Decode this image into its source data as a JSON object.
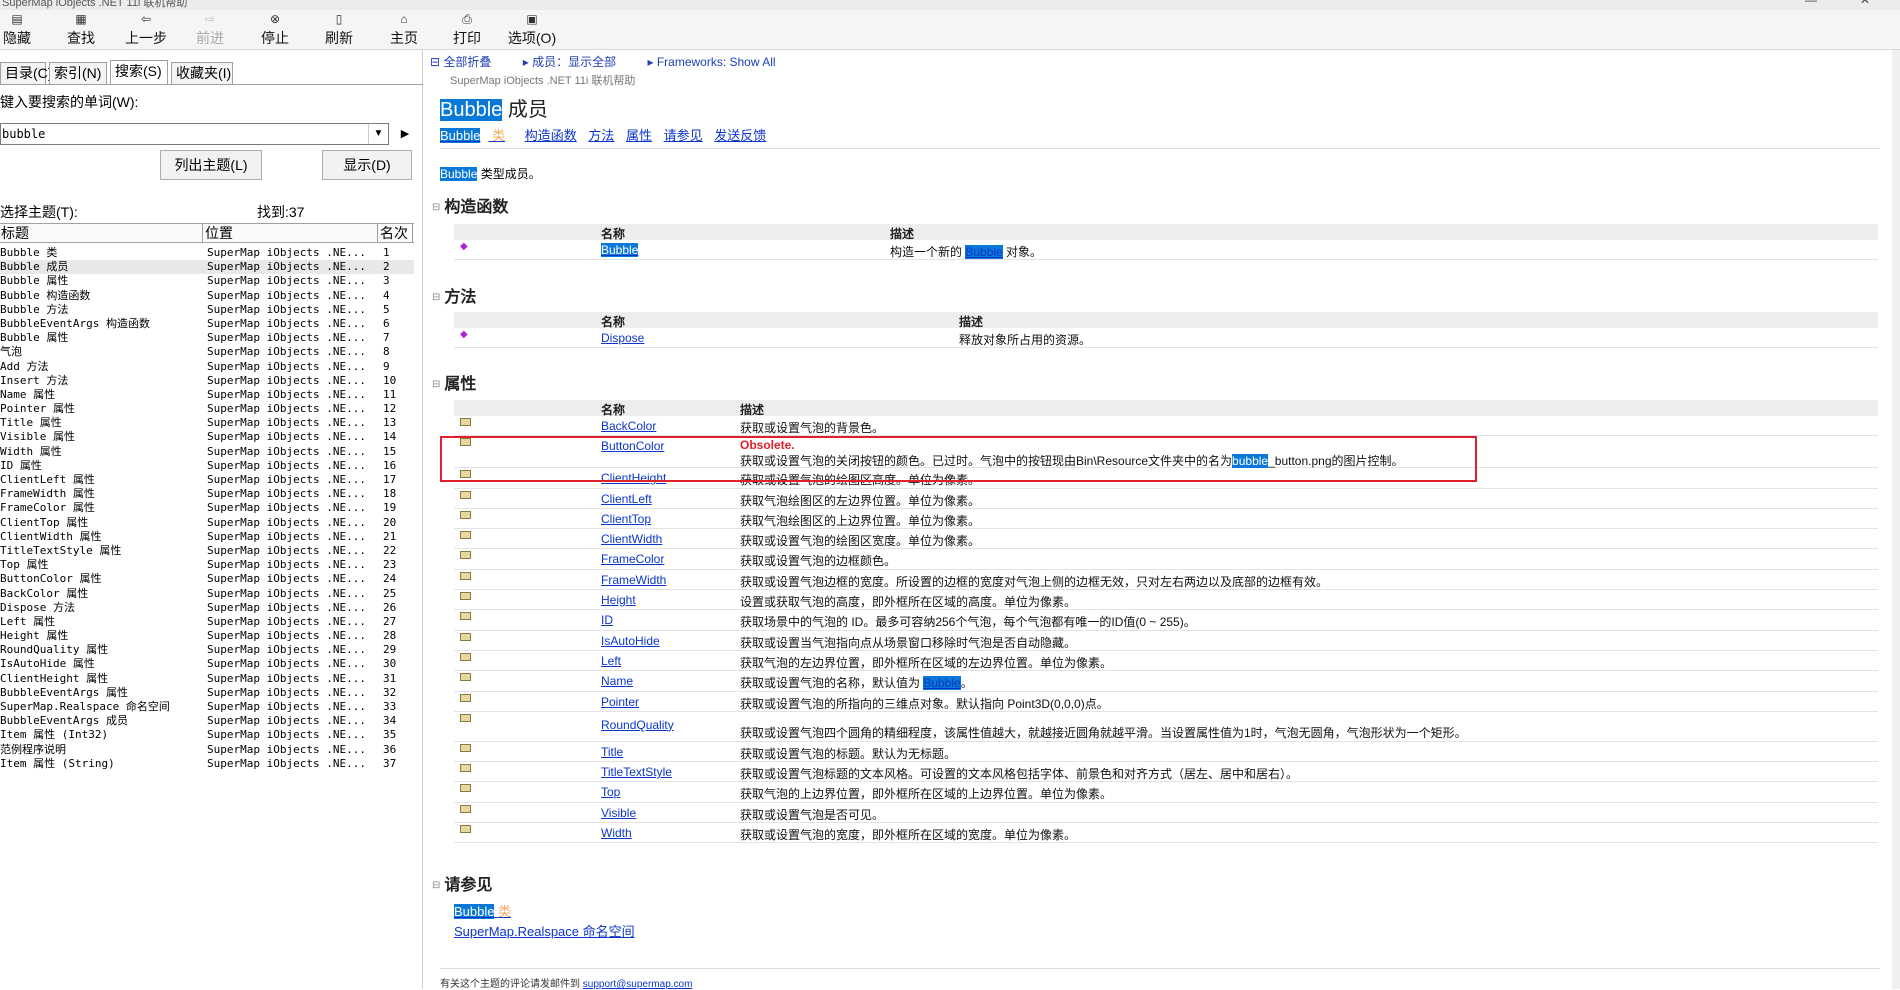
{
  "window": {
    "title": "SuperMap iObjects .NET 11i 联机帮助"
  },
  "toolbar": {
    "buttons": [
      {
        "label": "隐藏",
        "icon": "hide-icon",
        "enabled": true
      },
      {
        "label": "查找",
        "icon": "locate-icon",
        "enabled": true
      },
      {
        "label": "上一步",
        "icon": "back-arrow-icon",
        "enabled": true
      },
      {
        "label": "前进",
        "icon": "forward-arrow-icon",
        "enabled": false
      },
      {
        "label": "停止",
        "icon": "stop-icon",
        "enabled": true
      },
      {
        "label": "刷新",
        "icon": "refresh-icon",
        "enabled": true
      },
      {
        "label": "主页",
        "icon": "home-icon",
        "enabled": true
      },
      {
        "label": "打印",
        "icon": "print-icon",
        "enabled": true
      },
      {
        "label": "选项(O)",
        "icon": "options-icon",
        "enabled": true
      }
    ]
  },
  "left": {
    "tabs": [
      "目录(C)",
      "索引(N)",
      "搜索(S)",
      "收藏夹(I)"
    ],
    "active_tab": 2,
    "search_prompt": "键入要搜索的单词(W):",
    "search_value": "bubble",
    "list_topics_label": "列出主题(L)",
    "display_label": "显示(D)",
    "select_topic_label": "选择主题(T):",
    "found_label": "找到:37",
    "columns": [
      "标题",
      "位置",
      "名次"
    ],
    "results": [
      {
        "title": "Bubble 类",
        "location": "SuperMap iObjects .NE...",
        "rank": "1"
      },
      {
        "title": "Bubble 成员",
        "location": "SuperMap iObjects .NE...",
        "rank": "2"
      },
      {
        "title": "Bubble 属性",
        "location": "SuperMap iObjects .NE...",
        "rank": "3"
      },
      {
        "title": "Bubble 构造函数",
        "location": "SuperMap iObjects .NE...",
        "rank": "4"
      },
      {
        "title": "Bubble 方法",
        "location": "SuperMap iObjects .NE...",
        "rank": "5"
      },
      {
        "title": "BubbleEventArgs 构造函数",
        "location": "SuperMap iObjects .NE...",
        "rank": "6"
      },
      {
        "title": "Bubble 属性",
        "location": "SuperMap iObjects .NE...",
        "rank": "7"
      },
      {
        "title": "气泡",
        "location": "SuperMap iObjects .NE...",
        "rank": "8"
      },
      {
        "title": "Add 方法",
        "location": "SuperMap iObjects .NE...",
        "rank": "9"
      },
      {
        "title": "Insert 方法",
        "location": "SuperMap iObjects .NE...",
        "rank": "10"
      },
      {
        "title": "Name 属性",
        "location": "SuperMap iObjects .NE...",
        "rank": "11"
      },
      {
        "title": "Pointer 属性",
        "location": "SuperMap iObjects .NE...",
        "rank": "12"
      },
      {
        "title": "Title 属性",
        "location": "SuperMap iObjects .NE...",
        "rank": "13"
      },
      {
        "title": "Visible 属性",
        "location": "SuperMap iObjects .NE...",
        "rank": "14"
      },
      {
        "title": "Width 属性",
        "location": "SuperMap iObjects .NE...",
        "rank": "15"
      },
      {
        "title": "ID 属性",
        "location": "SuperMap iObjects .NE...",
        "rank": "16"
      },
      {
        "title": "ClientLeft 属性",
        "location": "SuperMap iObjects .NE...",
        "rank": "17"
      },
      {
        "title": "FrameWidth 属性",
        "location": "SuperMap iObjects .NE...",
        "rank": "18"
      },
      {
        "title": "FrameColor 属性",
        "location": "SuperMap iObjects .NE...",
        "rank": "19"
      },
      {
        "title": "ClientTop 属性",
        "location": "SuperMap iObjects .NE...",
        "rank": "20"
      },
      {
        "title": "ClientWidth 属性",
        "location": "SuperMap iObjects .NE...",
        "rank": "21"
      },
      {
        "title": "TitleTextStyle 属性",
        "location": "SuperMap iObjects .NE...",
        "rank": "22"
      },
      {
        "title": "Top 属性",
        "location": "SuperMap iObjects .NE...",
        "rank": "23"
      },
      {
        "title": "ButtonColor 属性",
        "location": "SuperMap iObjects .NE...",
        "rank": "24"
      },
      {
        "title": "BackColor 属性",
        "location": "SuperMap iObjects .NE...",
        "rank": "25"
      },
      {
        "title": "Dispose 方法",
        "location": "SuperMap iObjects .NE...",
        "rank": "26"
      },
      {
        "title": "Left 属性",
        "location": "SuperMap iObjects .NE...",
        "rank": "27"
      },
      {
        "title": "Height 属性",
        "location": "SuperMap iObjects .NE...",
        "rank": "28"
      },
      {
        "title": "RoundQuality 属性",
        "location": "SuperMap iObjects .NE...",
        "rank": "29"
      },
      {
        "title": "IsAutoHide 属性",
        "location": "SuperMap iObjects .NE...",
        "rank": "30"
      },
      {
        "title": "ClientHeight 属性",
        "location": "SuperMap iObjects .NE...",
        "rank": "31"
      },
      {
        "title": "BubbleEventArgs 属性",
        "location": "SuperMap iObjects .NE...",
        "rank": "32"
      },
      {
        "title": "SuperMap.Realspace 命名空间",
        "location": "SuperMap iObjects .NE...",
        "rank": "33"
      },
      {
        "title": "BubbleEventArgs 成员",
        "location": "SuperMap iObjects .NE...",
        "rank": "34"
      },
      {
        "title": "Item 属性 (Int32)",
        "location": "SuperMap iObjects .NE...",
        "rank": "35"
      },
      {
        "title": "范例程序说明",
        "location": "SuperMap iObjects .NE...",
        "rank": "36"
      },
      {
        "title": "Item 属性 (String)",
        "location": "SuperMap iObjects .NE...",
        "rank": "37"
      }
    ]
  },
  "doc": {
    "nav": [
      "全部折叠",
      "成员：显示全部",
      "Frameworks: Show All"
    ],
    "subtitle": "SuperMap iObjects .NET 11i 联机帮助",
    "title_hl": "Bubble",
    "title_rest": " 成员",
    "linkbar": {
      "class_hl": "Bubble",
      "class_suffix": " 类",
      "links": [
        "构造函数",
        "方法",
        "属性",
        "请参见",
        "发送反馈"
      ]
    },
    "intro_hl": "Bubble",
    "intro_rest": " 类型成员。",
    "col_name": "名称",
    "col_desc": "描述",
    "sections": {
      "ctor": {
        "title": "构造函数",
        "rows": [
          {
            "name": "Bubble",
            "desc_pre": "构造一个新的 ",
            "desc_hl": "Bubble",
            "desc_post": " 对象。"
          }
        ]
      },
      "methods": {
        "title": "方法",
        "rows": [
          {
            "name": "Dispose",
            "desc": "释放对象所占用的资源。"
          }
        ]
      },
      "props": {
        "title": "属性",
        "obsolete_label": "Obsolete.",
        "obsolete_desc_pre": "获取或设置气泡的关闭按钮的颜色。已过时。气泡中的按钮现由Bin\\Resource文件夹中的名为",
        "obsolete_desc_hl": "bubble",
        "obsolete_desc_post": "_button.png的图片控制。",
        "name_desc_pre": "获取或设置气泡的名称，默认值为 ",
        "name_desc_hl": "Bubble",
        "name_desc_post": "。",
        "rows": [
          {
            "name": "BackColor",
            "desc": "获取或设置气泡的背景色。"
          },
          {
            "name": "ButtonColor",
            "desc": ""
          },
          {
            "name": "ClientHeight",
            "desc": "获取或设置气泡的绘图区高度。单位为像素。"
          },
          {
            "name": "ClientLeft",
            "desc": "获取气泡绘图区的左边界位置。单位为像素。"
          },
          {
            "name": "ClientTop",
            "desc": "获取气泡绘图区的上边界位置。单位为像素。"
          },
          {
            "name": "ClientWidth",
            "desc": "获取或设置气泡的绘图区宽度。单位为像素。"
          },
          {
            "name": "FrameColor",
            "desc": "获取或设置气泡的边框颜色。"
          },
          {
            "name": "FrameWidth",
            "desc": "获取或设置气泡边框的宽度。所设置的边框的宽度对气泡上侧的边框无效，只对左右两边以及底部的边框有效。"
          },
          {
            "name": "Height",
            "desc": "设置或获取气泡的高度，即外框所在区域的高度。单位为像素。"
          },
          {
            "name": "ID",
            "desc": "获取场景中的气泡的 ID。最多可容纳256个气泡，每个气泡都有唯一的ID值(0 ~ 255)。"
          },
          {
            "name": "IsAutoHide",
            "desc": "获取或设置当气泡指向点从场景窗口移除时气泡是否自动隐藏。"
          },
          {
            "name": "Left",
            "desc": "获取气泡的左边界位置，即外框所在区域的左边界位置。单位为像素。"
          },
          {
            "name": "Name",
            "desc": ""
          },
          {
            "name": "Pointer",
            "desc": "获取或设置气泡的所指向的三维点对象。默认指向 Point3D(0,0,0)点。"
          },
          {
            "name": "RoundQuality",
            "desc": "获取或设置气泡四个圆角的精细程度，该属性值越大，就越接近圆角就越平滑。当设置属性值为1时，气泡无圆角，气泡形状为一个矩形。"
          },
          {
            "name": "Title",
            "desc": "获取或设置气泡的标题。默认为无标题。"
          },
          {
            "name": "TitleTextStyle",
            "desc": "获取或设置气泡标题的文本风格。可设置的文本风格包括字体、前景色和对齐方式（居左、居中和居右）。"
          },
          {
            "name": "Top",
            "desc": "获取气泡的上边界位置，即外框所在区域的上边界位置。单位为像素。"
          },
          {
            "name": "Visible",
            "desc": "获取或设置气泡是否可见。"
          },
          {
            "name": "Width",
            "desc": "获取或设置气泡的宽度，即外框所在区域的宽度。单位为像素。"
          }
        ]
      },
      "seealso": {
        "title": "请参见",
        "class_hl": "Bubble",
        "class_suffix": " 类",
        "namespace": "SuperMap.Realspace 命名空间"
      }
    },
    "footer_text": "有关这个主题的评论请发邮件到 ",
    "footer_email": "support@supermap.com"
  },
  "colors": {
    "highlight": "#0a78d7",
    "link": "#0b36c9",
    "obsolete": "#e0202a",
    "annotation_box": "#e0202a"
  }
}
